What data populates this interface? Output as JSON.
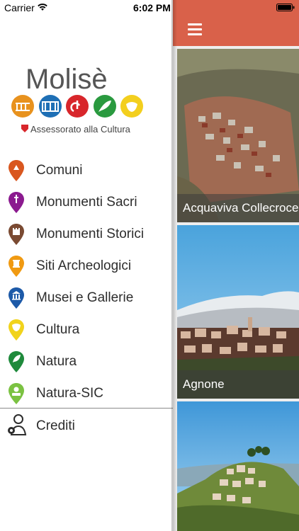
{
  "status_bar": {
    "carrier": "Carrier",
    "time": "6:02 PM"
  },
  "logo": {
    "title": "Molisè",
    "subtitle": "Assessorato alla Cultura"
  },
  "menu": {
    "items": [
      {
        "label": "Comuni",
        "color": "#d9571f"
      },
      {
        "label": "Monumenti Sacri",
        "color": "#8b1a8f"
      },
      {
        "label": "Monumenti Storici",
        "color": "#7a4a32"
      },
      {
        "label": "Siti Archeologici",
        "color": "#f09a12"
      },
      {
        "label": "Musei e Gallerie",
        "color": "#1d5aa8"
      },
      {
        "label": "Cultura",
        "color": "#f1d31c"
      },
      {
        "label": "Natura",
        "color": "#1f8a3c"
      },
      {
        "label": "Natura-SIC",
        "color": "#7bc242"
      }
    ],
    "credits_label": "Crediti"
  },
  "navbar": {
    "color": "#d9614a"
  },
  "cards": [
    {
      "caption": "Acquaviva Collecroce"
    },
    {
      "caption": "Agnone"
    },
    {
      "caption": ""
    }
  ]
}
